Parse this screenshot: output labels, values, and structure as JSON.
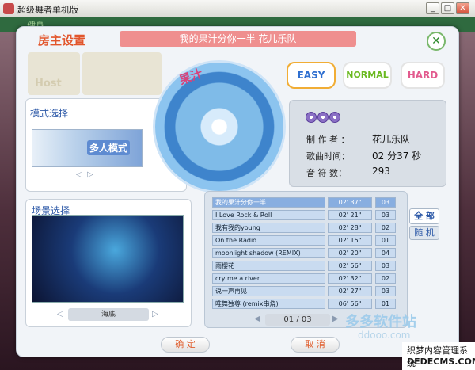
{
  "window": {
    "title": "超级舞者单机版",
    "controls": {
      "minimize": "_",
      "maximize": "□",
      "close": "✕"
    }
  },
  "background": {
    "top_text": "健身"
  },
  "dialog": {
    "title": "房主设置",
    "current_song": "我的果汁分你一半   花儿乐队",
    "close_symbol": "✕",
    "host_label": "Host"
  },
  "difficulty": {
    "easy": "EASY",
    "normal": "NORMAL",
    "hard": "HARD",
    "selected": "EASY"
  },
  "mode": {
    "heading": "模式选择",
    "image_label": "多人模式",
    "prev": "◁",
    "next": "▷"
  },
  "scene": {
    "heading": "场景选择",
    "name": "海底",
    "prev": "◁",
    "next": "▷"
  },
  "disc": {
    "label": "果汁"
  },
  "info": {
    "producer_label": "制 作 者 ：",
    "producer": "花儿乐队",
    "duration_label": "歌曲时间：",
    "duration": "02 分37 秒",
    "notes_label": "音 符 数：",
    "notes": "293"
  },
  "song_list": {
    "rows": [
      {
        "title": "我的果汁分你一半",
        "duration": "02' 37\"",
        "level": "03",
        "selected": true
      },
      {
        "title": "I Love Rock & Roll",
        "duration": "02' 21\"",
        "level": "03"
      },
      {
        "title": "我有我的young",
        "duration": "02' 28\"",
        "level": "02"
      },
      {
        "title": "On the Radio",
        "duration": "02' 15\"",
        "level": "01"
      },
      {
        "title": "moonlight shadow (REMIX)",
        "duration": "02' 20\"",
        "level": "04"
      },
      {
        "title": "雨樱花",
        "duration": "02' 56\"",
        "level": "03"
      },
      {
        "title": "cry me a river",
        "duration": "02' 32\"",
        "level": "02"
      },
      {
        "title": "说一声再见",
        "duration": "02' 27\"",
        "level": "03"
      },
      {
        "title": "唯舞独尊 (remix串烧)",
        "duration": "06' 56\"",
        "level": "01"
      }
    ],
    "filter_all": "全 部",
    "filter_random": "随 机",
    "page": "01 / 03",
    "prev": "◀",
    "next": "▶"
  },
  "buttons": {
    "ok": "确  定",
    "cancel": "取  消"
  },
  "watermark": {
    "logo": "多多软件站",
    "url": "ddooo.com",
    "line1": "织梦内容管理系统",
    "line2": "DEDECMS.COM"
  }
}
